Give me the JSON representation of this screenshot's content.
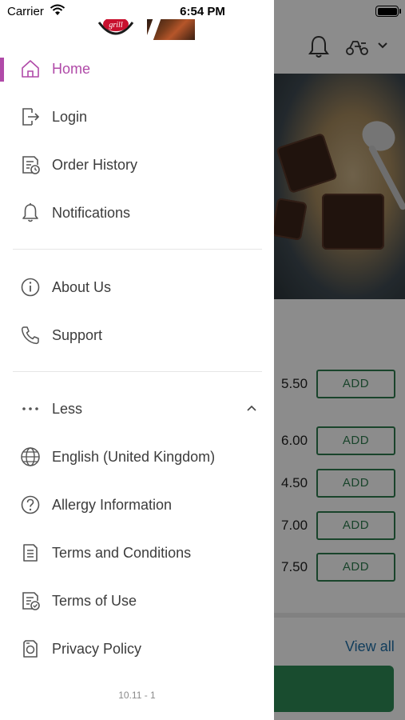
{
  "status_bar": {
    "carrier": "Carrier",
    "time": "6:54 PM"
  },
  "drawer": {
    "active_color": "#b04aa8",
    "primary_items": [
      {
        "label": "Home",
        "icon": "home-icon",
        "active": true
      },
      {
        "label": "Login",
        "icon": "login-icon"
      },
      {
        "label": "Order History",
        "icon": "order-history-icon"
      },
      {
        "label": "Notifications",
        "icon": "bell-icon"
      }
    ],
    "secondary_items": [
      {
        "label": "About Us",
        "icon": "info-icon"
      },
      {
        "label": "Support",
        "icon": "phone-icon"
      }
    ],
    "more_toggle": {
      "label": "Less",
      "icon": "more-dots-icon",
      "state_icon": "chevron-up-icon"
    },
    "extra_items": [
      {
        "label": "English (United Kingdom)",
        "icon": "globe-icon"
      },
      {
        "label": "Allergy Information",
        "icon": "question-icon"
      },
      {
        "label": "Terms and Conditions",
        "icon": "document-icon"
      },
      {
        "label": "Terms of Use",
        "icon": "document-check-icon"
      },
      {
        "label": "Privacy Policy",
        "icon": "privacy-icon"
      }
    ],
    "version": "10.11 - 1"
  },
  "background": {
    "menu_rows": [
      {
        "price": "5.50",
        "action": "ADD"
      },
      {
        "price": "6.00",
        "action": "ADD"
      },
      {
        "price": "4.50",
        "action": "ADD"
      },
      {
        "price": "7.00",
        "action": "ADD"
      },
      {
        "price": "7.50",
        "action": "ADD"
      }
    ],
    "view_all": "View all",
    "accent_color": "#2e7d4f"
  }
}
